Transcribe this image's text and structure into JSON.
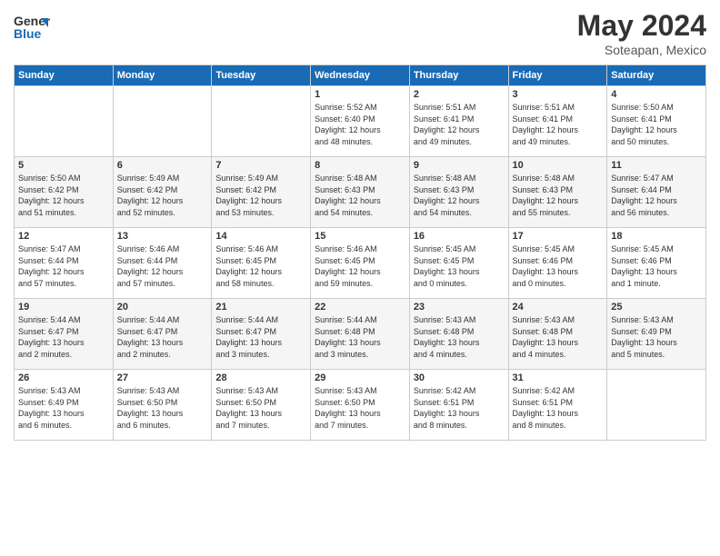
{
  "header": {
    "logo_general": "General",
    "logo_blue": "Blue",
    "month": "May 2024",
    "location": "Soteapan, Mexico"
  },
  "weekdays": [
    "Sunday",
    "Monday",
    "Tuesday",
    "Wednesday",
    "Thursday",
    "Friday",
    "Saturday"
  ],
  "weeks": [
    [
      {
        "day": "",
        "info": ""
      },
      {
        "day": "",
        "info": ""
      },
      {
        "day": "",
        "info": ""
      },
      {
        "day": "1",
        "info": "Sunrise: 5:52 AM\nSunset: 6:40 PM\nDaylight: 12 hours\nand 48 minutes."
      },
      {
        "day": "2",
        "info": "Sunrise: 5:51 AM\nSunset: 6:41 PM\nDaylight: 12 hours\nand 49 minutes."
      },
      {
        "day": "3",
        "info": "Sunrise: 5:51 AM\nSunset: 6:41 PM\nDaylight: 12 hours\nand 49 minutes."
      },
      {
        "day": "4",
        "info": "Sunrise: 5:50 AM\nSunset: 6:41 PM\nDaylight: 12 hours\nand 50 minutes."
      }
    ],
    [
      {
        "day": "5",
        "info": "Sunrise: 5:50 AM\nSunset: 6:42 PM\nDaylight: 12 hours\nand 51 minutes."
      },
      {
        "day": "6",
        "info": "Sunrise: 5:49 AM\nSunset: 6:42 PM\nDaylight: 12 hours\nand 52 minutes."
      },
      {
        "day": "7",
        "info": "Sunrise: 5:49 AM\nSunset: 6:42 PM\nDaylight: 12 hours\nand 53 minutes."
      },
      {
        "day": "8",
        "info": "Sunrise: 5:48 AM\nSunset: 6:43 PM\nDaylight: 12 hours\nand 54 minutes."
      },
      {
        "day": "9",
        "info": "Sunrise: 5:48 AM\nSunset: 6:43 PM\nDaylight: 12 hours\nand 54 minutes."
      },
      {
        "day": "10",
        "info": "Sunrise: 5:48 AM\nSunset: 6:43 PM\nDaylight: 12 hours\nand 55 minutes."
      },
      {
        "day": "11",
        "info": "Sunrise: 5:47 AM\nSunset: 6:44 PM\nDaylight: 12 hours\nand 56 minutes."
      }
    ],
    [
      {
        "day": "12",
        "info": "Sunrise: 5:47 AM\nSunset: 6:44 PM\nDaylight: 12 hours\nand 57 minutes."
      },
      {
        "day": "13",
        "info": "Sunrise: 5:46 AM\nSunset: 6:44 PM\nDaylight: 12 hours\nand 57 minutes."
      },
      {
        "day": "14",
        "info": "Sunrise: 5:46 AM\nSunset: 6:45 PM\nDaylight: 12 hours\nand 58 minutes."
      },
      {
        "day": "15",
        "info": "Sunrise: 5:46 AM\nSunset: 6:45 PM\nDaylight: 12 hours\nand 59 minutes."
      },
      {
        "day": "16",
        "info": "Sunrise: 5:45 AM\nSunset: 6:45 PM\nDaylight: 13 hours\nand 0 minutes."
      },
      {
        "day": "17",
        "info": "Sunrise: 5:45 AM\nSunset: 6:46 PM\nDaylight: 13 hours\nand 0 minutes."
      },
      {
        "day": "18",
        "info": "Sunrise: 5:45 AM\nSunset: 6:46 PM\nDaylight: 13 hours\nand 1 minute."
      }
    ],
    [
      {
        "day": "19",
        "info": "Sunrise: 5:44 AM\nSunset: 6:47 PM\nDaylight: 13 hours\nand 2 minutes."
      },
      {
        "day": "20",
        "info": "Sunrise: 5:44 AM\nSunset: 6:47 PM\nDaylight: 13 hours\nand 2 minutes."
      },
      {
        "day": "21",
        "info": "Sunrise: 5:44 AM\nSunset: 6:47 PM\nDaylight: 13 hours\nand 3 minutes."
      },
      {
        "day": "22",
        "info": "Sunrise: 5:44 AM\nSunset: 6:48 PM\nDaylight: 13 hours\nand 3 minutes."
      },
      {
        "day": "23",
        "info": "Sunrise: 5:43 AM\nSunset: 6:48 PM\nDaylight: 13 hours\nand 4 minutes."
      },
      {
        "day": "24",
        "info": "Sunrise: 5:43 AM\nSunset: 6:48 PM\nDaylight: 13 hours\nand 4 minutes."
      },
      {
        "day": "25",
        "info": "Sunrise: 5:43 AM\nSunset: 6:49 PM\nDaylight: 13 hours\nand 5 minutes."
      }
    ],
    [
      {
        "day": "26",
        "info": "Sunrise: 5:43 AM\nSunset: 6:49 PM\nDaylight: 13 hours\nand 6 minutes."
      },
      {
        "day": "27",
        "info": "Sunrise: 5:43 AM\nSunset: 6:50 PM\nDaylight: 13 hours\nand 6 minutes."
      },
      {
        "day": "28",
        "info": "Sunrise: 5:43 AM\nSunset: 6:50 PM\nDaylight: 13 hours\nand 7 minutes."
      },
      {
        "day": "29",
        "info": "Sunrise: 5:43 AM\nSunset: 6:50 PM\nDaylight: 13 hours\nand 7 minutes."
      },
      {
        "day": "30",
        "info": "Sunrise: 5:42 AM\nSunset: 6:51 PM\nDaylight: 13 hours\nand 8 minutes."
      },
      {
        "day": "31",
        "info": "Sunrise: 5:42 AM\nSunset: 6:51 PM\nDaylight: 13 hours\nand 8 minutes."
      },
      {
        "day": "",
        "info": ""
      }
    ]
  ]
}
